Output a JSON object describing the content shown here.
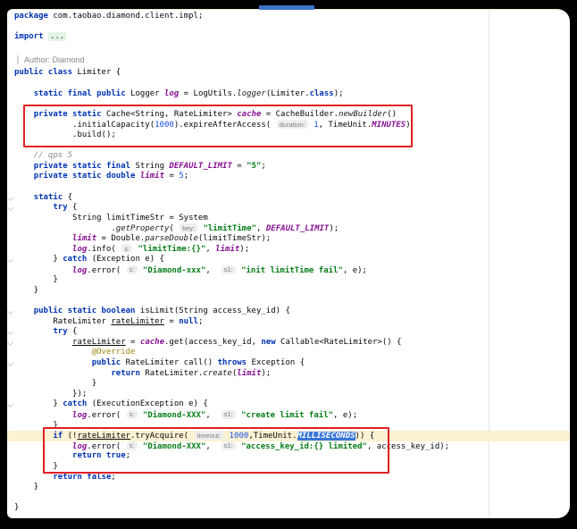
{
  "colors": {
    "accent_red": "#E02020",
    "selection_blue": "#3875D7",
    "current_line": "#FBF1D3",
    "keyword": "#0033B3",
    "string": "#067D17",
    "number": "#1750EB",
    "comment": "#8C8C8C",
    "field": "#871094",
    "annotation": "#9E880D",
    "fold_bg": "#E3F3E3",
    "hint_bg": "#EFEFEF",
    "hint_text": "#7E7E7E",
    "guide_line": "#E5E5E5",
    "frame_bg": "#000000",
    "editor_bg": "#FFFFFF",
    "top_bar_blue": "#3D74C9"
  },
  "editor": {
    "language": "java",
    "rendered_doc_comment": "Author: Diamond",
    "folded_import_placeholder": "...",
    "selected_token": "MILLISECONDS",
    "lines": [
      {
        "tokens": [
          [
            "kw",
            "package"
          ],
          [
            "pl",
            " com.taobao.diamond.client.impl;"
          ]
        ]
      },
      {
        "blank": true
      },
      {
        "tokens": [
          [
            "kw",
            "import"
          ],
          [
            "pl",
            " "
          ],
          [
            "fold",
            "..."
          ]
        ]
      },
      {
        "blank": true
      },
      {
        "doc": "Author: Diamond"
      },
      {
        "tokens": [
          [
            "kw",
            "public class"
          ],
          [
            "pl",
            " Limiter {"
          ]
        ]
      },
      {
        "blank": true
      },
      {
        "tokens": [
          [
            "pl",
            "    "
          ],
          [
            "kw",
            "static final public"
          ],
          [
            "pl",
            " Logger "
          ],
          [
            "fd",
            "log"
          ],
          [
            "pl",
            " = LogUtils."
          ],
          [
            "mt",
            "logger"
          ],
          [
            "pl",
            "(Limiter."
          ],
          [
            "kw",
            "class"
          ],
          [
            "pl",
            ");"
          ]
        ]
      },
      {
        "blank": true
      },
      {
        "tokens": [
          [
            "pl",
            "    "
          ],
          [
            "kw",
            "private static"
          ],
          [
            "pl",
            " Cache<String, RateLimiter> "
          ],
          [
            "fd",
            "cache"
          ],
          [
            "pl",
            " = CacheBuilder."
          ],
          [
            "mt",
            "newBuilder"
          ],
          [
            "pl",
            "()"
          ]
        ]
      },
      {
        "tokens": [
          [
            "pl",
            "            .initialCapacity("
          ],
          [
            "nm",
            "1000"
          ],
          [
            "pl",
            ").expireAfterAccess( "
          ],
          [
            "hint",
            "duration:"
          ],
          [
            "pl",
            " "
          ],
          [
            "nm",
            "1"
          ],
          [
            "pl",
            ", TimeUnit."
          ],
          [
            "fd",
            "MINUTES"
          ],
          [
            "pl",
            ")"
          ]
        ]
      },
      {
        "tokens": [
          [
            "pl",
            "            .build();"
          ]
        ]
      },
      {
        "blank": true
      },
      {
        "tokens": [
          [
            "cm",
            "    // qps 5"
          ]
        ]
      },
      {
        "tokens": [
          [
            "pl",
            "    "
          ],
          [
            "kw",
            "private static final"
          ],
          [
            "pl",
            " String "
          ],
          [
            "fd",
            "DEFAULT_LIMIT"
          ],
          [
            "pl",
            " = "
          ],
          [
            "st",
            "\"5\""
          ],
          [
            "pl",
            ";"
          ]
        ]
      },
      {
        "tokens": [
          [
            "pl",
            "    "
          ],
          [
            "kw",
            "private static double"
          ],
          [
            "pl",
            " "
          ],
          [
            "fd",
            "limit"
          ],
          [
            "pl",
            " = "
          ],
          [
            "nm",
            "5"
          ],
          [
            "pl",
            ";"
          ]
        ]
      },
      {
        "blank": true
      },
      {
        "fold": true,
        "tokens": [
          [
            "pl",
            "    "
          ],
          [
            "kw",
            "static"
          ],
          [
            "pl",
            " {"
          ]
        ]
      },
      {
        "fold": true,
        "tokens": [
          [
            "pl",
            "        "
          ],
          [
            "kw",
            "try"
          ],
          [
            "pl",
            " {"
          ]
        ]
      },
      {
        "tokens": [
          [
            "pl",
            "            String limitTimeStr = System"
          ]
        ]
      },
      {
        "tokens": [
          [
            "pl",
            "                    ."
          ],
          [
            "mt",
            "getProperty"
          ],
          [
            "pl",
            "( "
          ],
          [
            "hint",
            "key:"
          ],
          [
            "pl",
            " "
          ],
          [
            "st",
            "\"limitTime\""
          ],
          [
            "pl",
            ", "
          ],
          [
            "fd",
            "DEFAULT_LIMIT"
          ],
          [
            "pl",
            ");"
          ]
        ]
      },
      {
        "tokens": [
          [
            "pl",
            "            "
          ],
          [
            "fd",
            "limit"
          ],
          [
            "pl",
            " = Double."
          ],
          [
            "mt",
            "parseDouble"
          ],
          [
            "pl",
            "(limitTimeStr);"
          ]
        ]
      },
      {
        "tokens": [
          [
            "pl",
            "            "
          ],
          [
            "fd",
            "log"
          ],
          [
            "pl",
            ".info( "
          ],
          [
            "hint",
            "s:"
          ],
          [
            "pl",
            " "
          ],
          [
            "st",
            "\"limitTime:{}\""
          ],
          [
            "pl",
            ", "
          ],
          [
            "fd",
            "limit"
          ],
          [
            "pl",
            ");"
          ]
        ]
      },
      {
        "fold": true,
        "tokens": [
          [
            "pl",
            "        } "
          ],
          [
            "kw",
            "catch"
          ],
          [
            "pl",
            " (Exception e) {"
          ]
        ]
      },
      {
        "tokens": [
          [
            "pl",
            "            "
          ],
          [
            "fd",
            "log"
          ],
          [
            "pl",
            ".error( "
          ],
          [
            "hint",
            "s:"
          ],
          [
            "pl",
            " "
          ],
          [
            "st",
            "\"Diamond-xxx\""
          ],
          [
            "pl",
            ",  "
          ],
          [
            "hint",
            "s1:"
          ],
          [
            "pl",
            " "
          ],
          [
            "st",
            "\"init limitTime fail\""
          ],
          [
            "pl",
            ", e);"
          ]
        ]
      },
      {
        "tokens": [
          [
            "pl",
            "        }"
          ]
        ]
      },
      {
        "tokens": [
          [
            "pl",
            "    }"
          ]
        ]
      },
      {
        "blank": true
      },
      {
        "fold": true,
        "tokens": [
          [
            "pl",
            "    "
          ],
          [
            "kw",
            "public static boolean"
          ],
          [
            "pl",
            " isLimit(String access_key_id) {"
          ]
        ]
      },
      {
        "tokens": [
          [
            "pl",
            "        RateLimiter "
          ],
          [
            "un",
            "rateLimiter"
          ],
          [
            "pl",
            " = "
          ],
          [
            "kw",
            "null"
          ],
          [
            "pl",
            ";"
          ]
        ]
      },
      {
        "fold": true,
        "tokens": [
          [
            "pl",
            "        "
          ],
          [
            "kw",
            "try"
          ],
          [
            "pl",
            " {"
          ]
        ]
      },
      {
        "fold": true,
        "tokens": [
          [
            "pl",
            "            "
          ],
          [
            "un",
            "rateLimiter"
          ],
          [
            "pl",
            " = "
          ],
          [
            "fd",
            "cache"
          ],
          [
            "pl",
            ".get(access_key_id, "
          ],
          [
            "kw",
            "new"
          ],
          [
            "pl",
            " Callable<RateLimiter>() {"
          ]
        ]
      },
      {
        "tokens": [
          [
            "pl",
            "                "
          ],
          [
            "an",
            "@Override"
          ]
        ]
      },
      {
        "fold": true,
        "tokens": [
          [
            "pl",
            "                "
          ],
          [
            "kw",
            "public"
          ],
          [
            "pl",
            " RateLimiter call() "
          ],
          [
            "kw",
            "throws"
          ],
          [
            "pl",
            " Exception {"
          ]
        ]
      },
      {
        "tokens": [
          [
            "pl",
            "                    "
          ],
          [
            "kw",
            "return"
          ],
          [
            "pl",
            " RateLimiter."
          ],
          [
            "mt",
            "create"
          ],
          [
            "pl",
            "("
          ],
          [
            "fd",
            "limit"
          ],
          [
            "pl",
            ");"
          ]
        ]
      },
      {
        "tokens": [
          [
            "pl",
            "                }"
          ]
        ]
      },
      {
        "tokens": [
          [
            "pl",
            "            });"
          ]
        ]
      },
      {
        "fold": true,
        "tokens": [
          [
            "pl",
            "        } "
          ],
          [
            "kw",
            "catch"
          ],
          [
            "pl",
            " (ExecutionException e) {"
          ]
        ]
      },
      {
        "tokens": [
          [
            "pl",
            "            "
          ],
          [
            "fd",
            "log"
          ],
          [
            "pl",
            ".error( "
          ],
          [
            "hint",
            "s:"
          ],
          [
            "pl",
            " "
          ],
          [
            "st",
            "\"Diamond-XXX\""
          ],
          [
            "pl",
            ",  "
          ],
          [
            "hint",
            "s1:"
          ],
          [
            "pl",
            " "
          ],
          [
            "st",
            "\"create limit fail\""
          ],
          [
            "pl",
            ", e);"
          ]
        ]
      },
      {
        "tokens": [
          [
            "pl",
            "        }"
          ]
        ]
      },
      {
        "hl": true,
        "fold": true,
        "tokens": [
          [
            "pl",
            "        "
          ],
          [
            "kw",
            "if"
          ],
          [
            "pl",
            " (!"
          ],
          [
            "un",
            "rateLimiter"
          ],
          [
            "pl",
            ".tryAcquire( "
          ],
          [
            "hint",
            "timeout:"
          ],
          [
            "pl",
            " "
          ],
          [
            "nm",
            "1000"
          ],
          [
            "pl",
            ",TimeUnit."
          ],
          [
            "sel",
            "MILLISECONDS"
          ],
          [
            "pl",
            ")) {"
          ]
        ]
      },
      {
        "tokens": [
          [
            "pl",
            "            "
          ],
          [
            "fd",
            "log"
          ],
          [
            "pl",
            ".error( "
          ],
          [
            "hint",
            "s:"
          ],
          [
            "pl",
            " "
          ],
          [
            "st",
            "\"Diamond-XXX\""
          ],
          [
            "pl",
            ",  "
          ],
          [
            "hint",
            "s1:"
          ],
          [
            "pl",
            " "
          ],
          [
            "st",
            "\"access_key_id:{} limited\""
          ],
          [
            "pl",
            ", access_key_id);"
          ]
        ]
      },
      {
        "tokens": [
          [
            "pl",
            "            "
          ],
          [
            "kw",
            "return"
          ],
          [
            "pl",
            " "
          ],
          [
            "kw",
            "true"
          ],
          [
            "pl",
            ";"
          ]
        ]
      },
      {
        "tokens": [
          [
            "pl",
            "        }"
          ]
        ]
      },
      {
        "tokens": [
          [
            "pl",
            "        "
          ],
          [
            "kw",
            "return"
          ],
          [
            "pl",
            " "
          ],
          [
            "kw",
            "false"
          ],
          [
            "pl",
            ";"
          ]
        ]
      },
      {
        "tokens": [
          [
            "pl",
            "    }"
          ]
        ]
      },
      {
        "blank": true
      },
      {
        "tokens": [
          [
            "pl",
            "}"
          ]
        ]
      }
    ]
  }
}
